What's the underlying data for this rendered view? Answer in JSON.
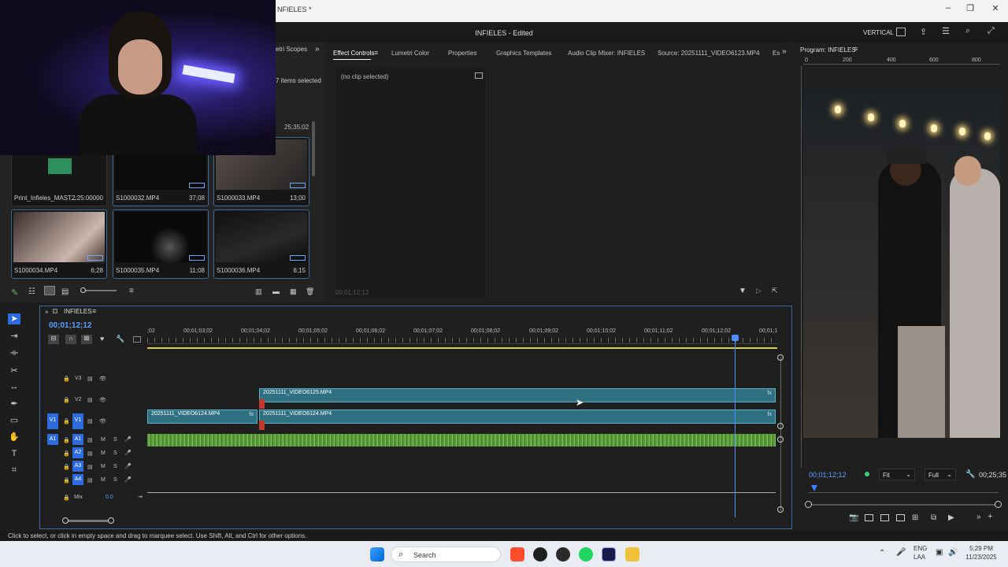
{
  "window": {
    "title": "NFIELES *"
  },
  "header": {
    "project_title": "INFIELES - Edited",
    "workspace": "VERTICAL"
  },
  "project_panel": {
    "tab_fragment": "etri Scopes",
    "selection": "7 items selected",
    "duration_header": "25;35;02",
    "items": [
      {
        "name": "Print_Infieles_MAST...",
        "duration": "2:25:00000"
      },
      {
        "name": "S1000032.MP4",
        "duration": "37;08"
      },
      {
        "name": "S1000033.MP4",
        "duration": "13;00"
      },
      {
        "name": "S1000034.MP4",
        "duration": "6;28"
      },
      {
        "name": "S1000035.MP4",
        "duration": "11;08"
      },
      {
        "name": "S1000036.MP4",
        "duration": "6;15"
      }
    ]
  },
  "effects_panel": {
    "tabs": [
      "Effect Controls",
      "Lumetri Color",
      "Properties",
      "Graphics Templates",
      "Audio Clip Mixer: INFIELES",
      "Source: 20251111_VIDEO6123.MP4",
      "Es"
    ],
    "no_clip": "(no clip selected)",
    "timecode": "00;01;12;12"
  },
  "program_monitor": {
    "title": "Program: INFIELES",
    "ruler": [
      "0",
      "200",
      "400",
      "600",
      "800"
    ],
    "timecode": "00;01;12;12",
    "fit": "Fit",
    "quality": "Full",
    "duration": "00;25;35"
  },
  "timeline": {
    "sequence": "INFIELES",
    "timecode": "00;01;12;12",
    "ruler": [
      ";02",
      "00;01;03;02",
      "00;01;04;02",
      "00;01;05;02",
      "00;01;06;02",
      "00;01;07;02",
      "00;01;08;02",
      "00;01;09;02",
      "00;01;10;02",
      "00;01;11;02",
      "00;01;12;02",
      "00;01;1"
    ],
    "tracks": {
      "v3": "V3",
      "v2": "V2",
      "v1": "V1",
      "v1_src": "V1",
      "a1": "A1",
      "a1_src": "A1",
      "a2": "A2",
      "a3": "A3",
      "a4": "A4",
      "mix": "Mix",
      "mix_value": "0.0",
      "m": "M",
      "s": "S"
    },
    "clips": {
      "v2": "20251111_VIDEO6125.MP4",
      "v1_a": "20251111_VIDEO6124.MP4",
      "v1_b": "20251111_VIDEO6124.MP4",
      "fx": "fx"
    }
  },
  "status": "Click to select, or click in empty space and drag to marquee select. Use Shift, Alt, and Ctrl for other options.",
  "taskbar": {
    "search": "Search",
    "lang_top": "ENG",
    "lang_bottom": "LAA",
    "time": "5:29 PM",
    "date": "11/23/2025"
  }
}
